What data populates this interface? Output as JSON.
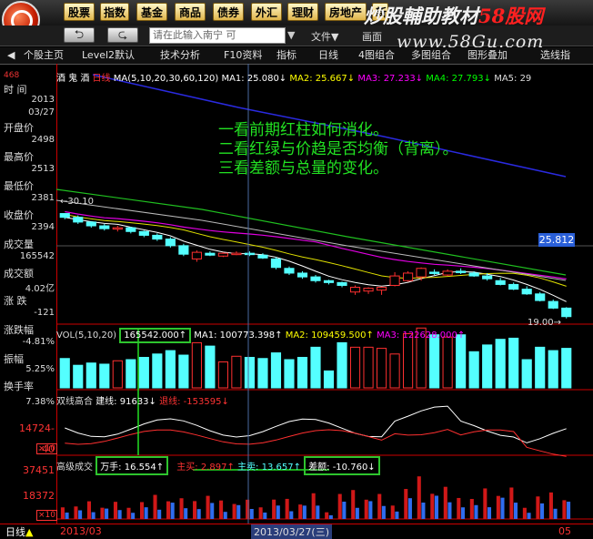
{
  "toolbar": {
    "buttons": [
      "股票",
      "指数",
      "基金",
      "商品",
      "债券",
      "外汇",
      "理财",
      "房地产",
      "新"
    ],
    "watermark_line1_black": "炒股輔助教材",
    "watermark_line1_red": "58股网",
    "watermark_line2": "www.58Gu.com"
  },
  "secondbar": {
    "search_placeholder": "请在此输入南宁  可",
    "search_go": "▼",
    "menu_file": "文件▼",
    "menu_view": "画面"
  },
  "tabs": [
    "◀",
    "个股主页",
    "Level2默认",
    "技术分析",
    "F10资料",
    "指标",
    "日线",
    "4图组合",
    "多图组合",
    "图形叠加",
    "选线指"
  ],
  "left_panel": {
    "items": [
      {
        "label": "时  间",
        "value": "2013"
      },
      {
        "label": "",
        "value": "03/27"
      },
      {
        "label": "开盘价",
        "value": "2498"
      },
      {
        "label": "最高价",
        "value": "2513"
      },
      {
        "label": "最低价",
        "value": "2381"
      },
      {
        "label": "收盘价",
        "value": "2394"
      },
      {
        "label": "成交量",
        "value": "165542"
      },
      {
        "label": "成交额",
        "value": "4.02亿"
      },
      {
        "label": "涨  跌",
        "value": "-121"
      },
      {
        "label": "涨跌幅",
        "value": "-4.81%"
      },
      {
        "label": "振幅",
        "value": "5.25%"
      },
      {
        "label": "换手率",
        "value": "7.38%"
      }
    ],
    "top_tag": "468"
  },
  "main_header": {
    "stock": "酒 鬼 酒",
    "period": "日线",
    "ma_def": "MA(5,10,20,30,60,120)",
    "ma1": "MA1: 25.080↓",
    "ma2": "MA2: 25.667↓",
    "ma3": "MA3: 27.233↓",
    "ma4": "MA4: 27.793↓",
    "ma5": "MA5: 29"
  },
  "notes": [
    "一看前期红柱如何消化。",
    "二看红绿与价趋是否均衡（背离）。",
    "三看差额与总量的变化。"
  ],
  "price_labels": {
    "high": "30.10",
    "current": "25.812",
    "low": "19.00"
  },
  "volume_header": {
    "def": "VOL(5,10,20)",
    "value": "165542.000↑",
    "ma1": "MA1: 100773.398↑",
    "ma2": "MA2: 109459.500↑",
    "ma3": "MA3: 122628.000↑"
  },
  "sub_header": {
    "name": "双线高合",
    "line1": "建线: 91633↓",
    "line2": "退线: -153595↓"
  },
  "sub_axis": [
    "14724-",
    "-40",
    "×10"
  ],
  "kv_header": {
    "name": "高级成交",
    "wanshou": "万手: 16.554↑",
    "zhumai": "主买: 2.897↑",
    "zhumai2": "主卖: 13.657↑",
    "chae": "差额: -10.760↓"
  },
  "kv_axis": [
    "37451",
    "18372",
    "×10"
  ],
  "status": {
    "period": "日线",
    "date_left": "2013/03",
    "date_cursor": "2013/03/27(三)",
    "date_right": "05"
  },
  "colors": {
    "up": "#ff3030",
    "down": "#54ffff",
    "note_green": "#22e022",
    "cursor": "#4a6aa0"
  },
  "chart_data": {
    "type": "candlestick",
    "title": "酒 鬼 酒 日线",
    "ohlc": [
      [
        30.1,
        30.1,
        29.5,
        29.7
      ],
      [
        29.7,
        29.9,
        29.0,
        29.2
      ],
      [
        29.2,
        29.3,
        28.6,
        28.8
      ],
      [
        28.8,
        29.0,
        28.3,
        28.5
      ],
      [
        28.5,
        28.8,
        28.2,
        28.6
      ],
      [
        28.6,
        28.7,
        28.0,
        28.2
      ],
      [
        28.2,
        28.3,
        27.6,
        27.8
      ],
      [
        27.8,
        28.0,
        27.2,
        27.4
      ],
      [
        27.4,
        27.6,
        26.5,
        26.7
      ],
      [
        26.7,
        26.9,
        25.6,
        25.8
      ],
      [
        25.3,
        26.2,
        25.0,
        26.0
      ],
      [
        25.9,
        26.1,
        25.6,
        25.7
      ],
      [
        25.6,
        26.0,
        25.5,
        25.9
      ],
      [
        25.8,
        26.1,
        25.7,
        25.9
      ],
      [
        25.9,
        26.1,
        25.6,
        25.8
      ],
      [
        25.7,
        25.9,
        25.3,
        25.4
      ],
      [
        25.3,
        25.5,
        24.2,
        24.4
      ],
      [
        24.3,
        24.5,
        23.6,
        23.8
      ],
      [
        23.8,
        24.0,
        23.2,
        23.4
      ],
      [
        23.4,
        23.6,
        22.8,
        23.0
      ],
      [
        23.0,
        23.1,
        22.6,
        22.8
      ],
      [
        22.8,
        22.9,
        22.3,
        22.5
      ],
      [
        21.8,
        22.5,
        21.5,
        22.3
      ],
      [
        21.9,
        22.3,
        21.6,
        22.2
      ],
      [
        22.0,
        22.4,
        21.5,
        22.3
      ],
      [
        22.5,
        23.9,
        22.4,
        23.5
      ],
      [
        23.0,
        24.0,
        22.9,
        23.8
      ],
      [
        23.4,
        24.4,
        23.0,
        24.3
      ],
      [
        23.9,
        24.2,
        23.6,
        23.8
      ],
      [
        23.6,
        24.2,
        23.5,
        24.0
      ],
      [
        24.0,
        24.3,
        23.7,
        23.9
      ],
      [
        23.8,
        24.0,
        23.4,
        23.5
      ],
      [
        23.5,
        23.8,
        23.0,
        23.2
      ],
      [
        23.0,
        23.3,
        22.5,
        22.6
      ],
      [
        22.6,
        22.8,
        22.0,
        22.1
      ],
      [
        22.1,
        22.4,
        21.5,
        21.6
      ],
      [
        21.6,
        21.8,
        20.8,
        20.9
      ],
      [
        20.8,
        21.0,
        20.0,
        20.1
      ],
      [
        20.1,
        20.2,
        19.0,
        19.2
      ]
    ],
    "volume": [
      26,
      20,
      22,
      21,
      24,
      25,
      27,
      30,
      33,
      29,
      40,
      37,
      23,
      28,
      27,
      26,
      31,
      25,
      27,
      36,
      15,
      40,
      36,
      36,
      35,
      30,
      48,
      53,
      47,
      45,
      47,
      32,
      38,
      43,
      44,
      25,
      36,
      33,
      35
    ],
    "volume_ma": [
      100773.398,
      109459.5,
      122628.0
    ],
    "ylim": [
      18.5,
      31.5
    ],
    "ma_lines": [
      "MA1",
      "MA2",
      "MA3",
      "MA4",
      "MA5"
    ]
  }
}
